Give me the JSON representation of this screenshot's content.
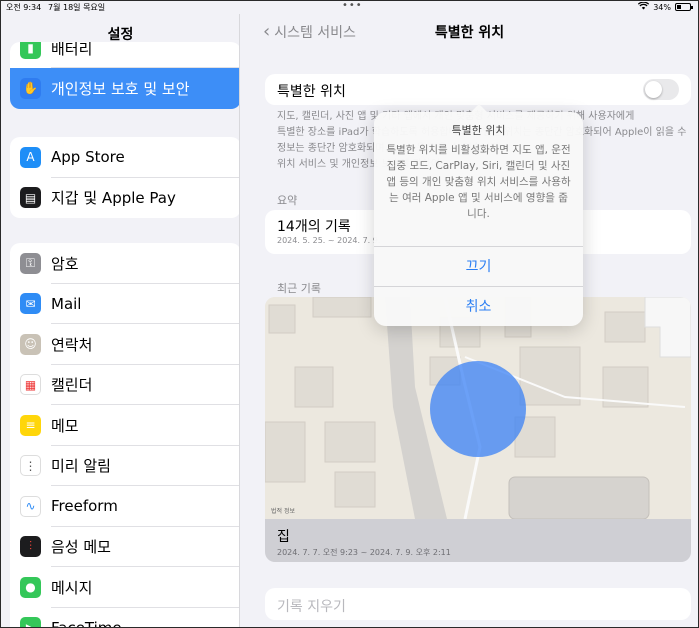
{
  "status": {
    "time": "오전 9:34",
    "date": "7월 18일 목요일",
    "battery": "34%"
  },
  "sidebar": {
    "title": "설정",
    "partial_item": "배터리",
    "selected_item": "개인정보 보호 및 보안",
    "group2": [
      "App Store",
      "지갑 및 Apple Pay"
    ],
    "group3": [
      "암호",
      "Mail",
      "연락처",
      "캘린더",
      "메모",
      "미리 알림",
      "Freeform",
      "음성 메모",
      "메시지",
      "FaceTime"
    ]
  },
  "main": {
    "back_label": "시스템 서비스",
    "title": "특별한 위치",
    "toggle_label": "특별한 위치",
    "toggle_on": false,
    "footer_text_line1": "지도, 캘린더, 사진 앱 및 기타 앱에서 개인 맞춤형 서비스를 제공하기 위해 사용자에게",
    "footer_text_line2": "특별한 장소를 iPad가 학습하도록 허용합니다. 특별한 위치는 종단간 암호화되어 Apple이 읽을 수 없습니다. 특별한 위치",
    "footer_text_line3": "정보는 종단간 암호화되며 Apple은 읽을 수 없습니다.",
    "footer_text_line4": "위치 서비스 및 개인정보 보호에 관하여...",
    "summary_header": "요약",
    "summary_title": "14개의 기록",
    "summary_range": "2024. 5. 25. ~ 2024. 7. 9.",
    "recent_header": "최근 기록",
    "map_legal": "법적 정보",
    "recent_place": "집",
    "recent_range": "2024. 7. 7. 오전 9:23 ~ 2024. 7. 9. 오후 2:11",
    "clear_history": "기록 지우기"
  },
  "popover": {
    "title": "특별한 위치",
    "message": "특별한 위치를 비활성화하면 지도 앱, 운전 집중 모드, CarPlay, Siri, 캘린더 및 사진 앱 등의 개인 맞춤형 위치 서비스를 사용하는 여러 Apple 앱 및 서비스에 영향을 줍니다.",
    "confirm": "끄기",
    "cancel": "취소"
  }
}
